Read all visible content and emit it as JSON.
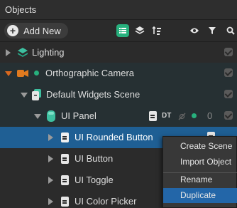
{
  "panel": {
    "title": "Objects"
  },
  "toolbar": {
    "add_label": "Add New",
    "accent": "#27b07d"
  },
  "tree": [
    {
      "label": "Lighting",
      "icon": "layers-icon"
    },
    {
      "label": "Orthographic Camera",
      "icon": "camera-icon"
    },
    {
      "label": "Default Widgets Scene",
      "icon": "scene-icon"
    },
    {
      "label": "UI Panel",
      "icon": "panel-icon",
      "badge": "DT",
      "count": "0"
    },
    {
      "label": "UI Rounded Button",
      "icon": "document-icon"
    },
    {
      "label": "UI Button",
      "icon": "document-icon"
    },
    {
      "label": "UI Toggle",
      "icon": "document-icon"
    },
    {
      "label": "UI Color Picker",
      "icon": "document-icon"
    }
  ],
  "context_menu": {
    "items": [
      "Create Scene",
      "Import Object",
      "Rename",
      "Duplicate"
    ],
    "highlighted": "Duplicate"
  },
  "colors": {
    "selection": "#1f5f94",
    "menu_highlight": "#2366a8",
    "camera": "#e07a1f"
  }
}
